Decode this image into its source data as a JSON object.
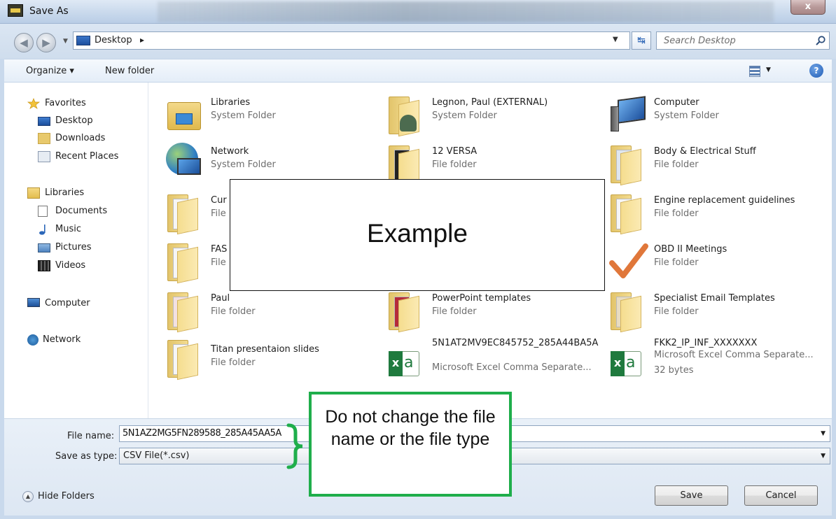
{
  "window": {
    "title": "Save As",
    "close_label": "x"
  },
  "address": {
    "location": "Desktop",
    "search_placeholder": "Search Desktop"
  },
  "toolbar": {
    "organize": "Organize ▾",
    "new_folder": "New folder",
    "help": "?"
  },
  "nav": {
    "favorites": "Favorites",
    "desktop": "Desktop",
    "downloads": "Downloads",
    "recent_places": "Recent Places",
    "libraries": "Libraries",
    "documents": "Documents",
    "music": "Music",
    "pictures": "Pictures",
    "videos": "Videos",
    "computer": "Computer",
    "network": "Network"
  },
  "files": [
    {
      "name": "Libraries",
      "type": "System Folder"
    },
    {
      "name": "Legnon, Paul (EXTERNAL)",
      "type": "System Folder"
    },
    {
      "name": "Computer",
      "type": "System Folder"
    },
    {
      "name": "Network",
      "type": "System Folder"
    },
    {
      "name": "12 VERSA",
      "type": "File folder"
    },
    {
      "name": "Body & Electrical Stuff",
      "type": "File folder"
    },
    {
      "name": "Cur",
      "type": "File"
    },
    {
      "name": "Engine replacement guidelines",
      "type": "File folder"
    },
    {
      "name": "FAS",
      "type": "File"
    },
    {
      "name": "OBD II Meetings",
      "type": "File folder"
    },
    {
      "name": "Paul",
      "type": "File folder"
    },
    {
      "name": "PowerPoint templates",
      "type": "File folder"
    },
    {
      "name": "Specialist Email Templates",
      "type": "File folder"
    },
    {
      "name": "Titan presentaion slides",
      "type": "File folder"
    },
    {
      "name": "5N1AT2MV9EC845752_285A44BA5A",
      "type": "Microsoft Excel Comma Separate..."
    },
    {
      "name": "FKK2_IP_INF_XXXXXXX",
      "type": "Microsoft Excel Comma Separate...",
      "size": "32 bytes"
    }
  ],
  "overlay": {
    "example": "Example"
  },
  "form": {
    "file_name_label": "File name:",
    "file_name_value": "5N1AZ2MG5FN289588_285A45AA5A",
    "save_type_label": "Save as type:",
    "save_type_value": "CSV File(*.csv)"
  },
  "footer": {
    "hide_folders": "Hide Folders",
    "save": "Save",
    "cancel": "Cancel"
  },
  "callout": {
    "text": "Do not change the file name or the file type"
  },
  "colors": {
    "callout_border": "#1fae4b",
    "titlebar": "#c9d9ec"
  }
}
